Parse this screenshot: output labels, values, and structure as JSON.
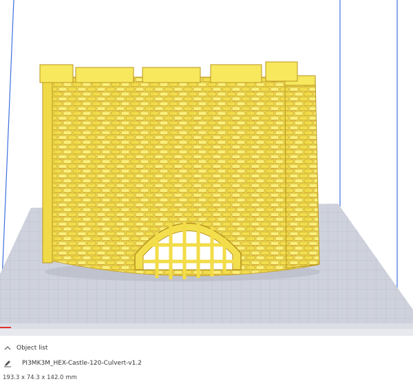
{
  "viewport": {
    "model_name": "castle-tower-model",
    "build_color": "#f6e65a",
    "plate_color": "#c9ccd6",
    "volume_line_color": "#3b6fe0"
  },
  "object_panel": {
    "toggle_icon": "chevron-up-icon",
    "header_label": "Object list",
    "edit_icon": "pencil-icon",
    "file_name": "PI3MK3M_HEX-Castle-120-Culvert-v1.2",
    "dimensions": "193.3 x 74.3 x 142.0 mm"
  }
}
